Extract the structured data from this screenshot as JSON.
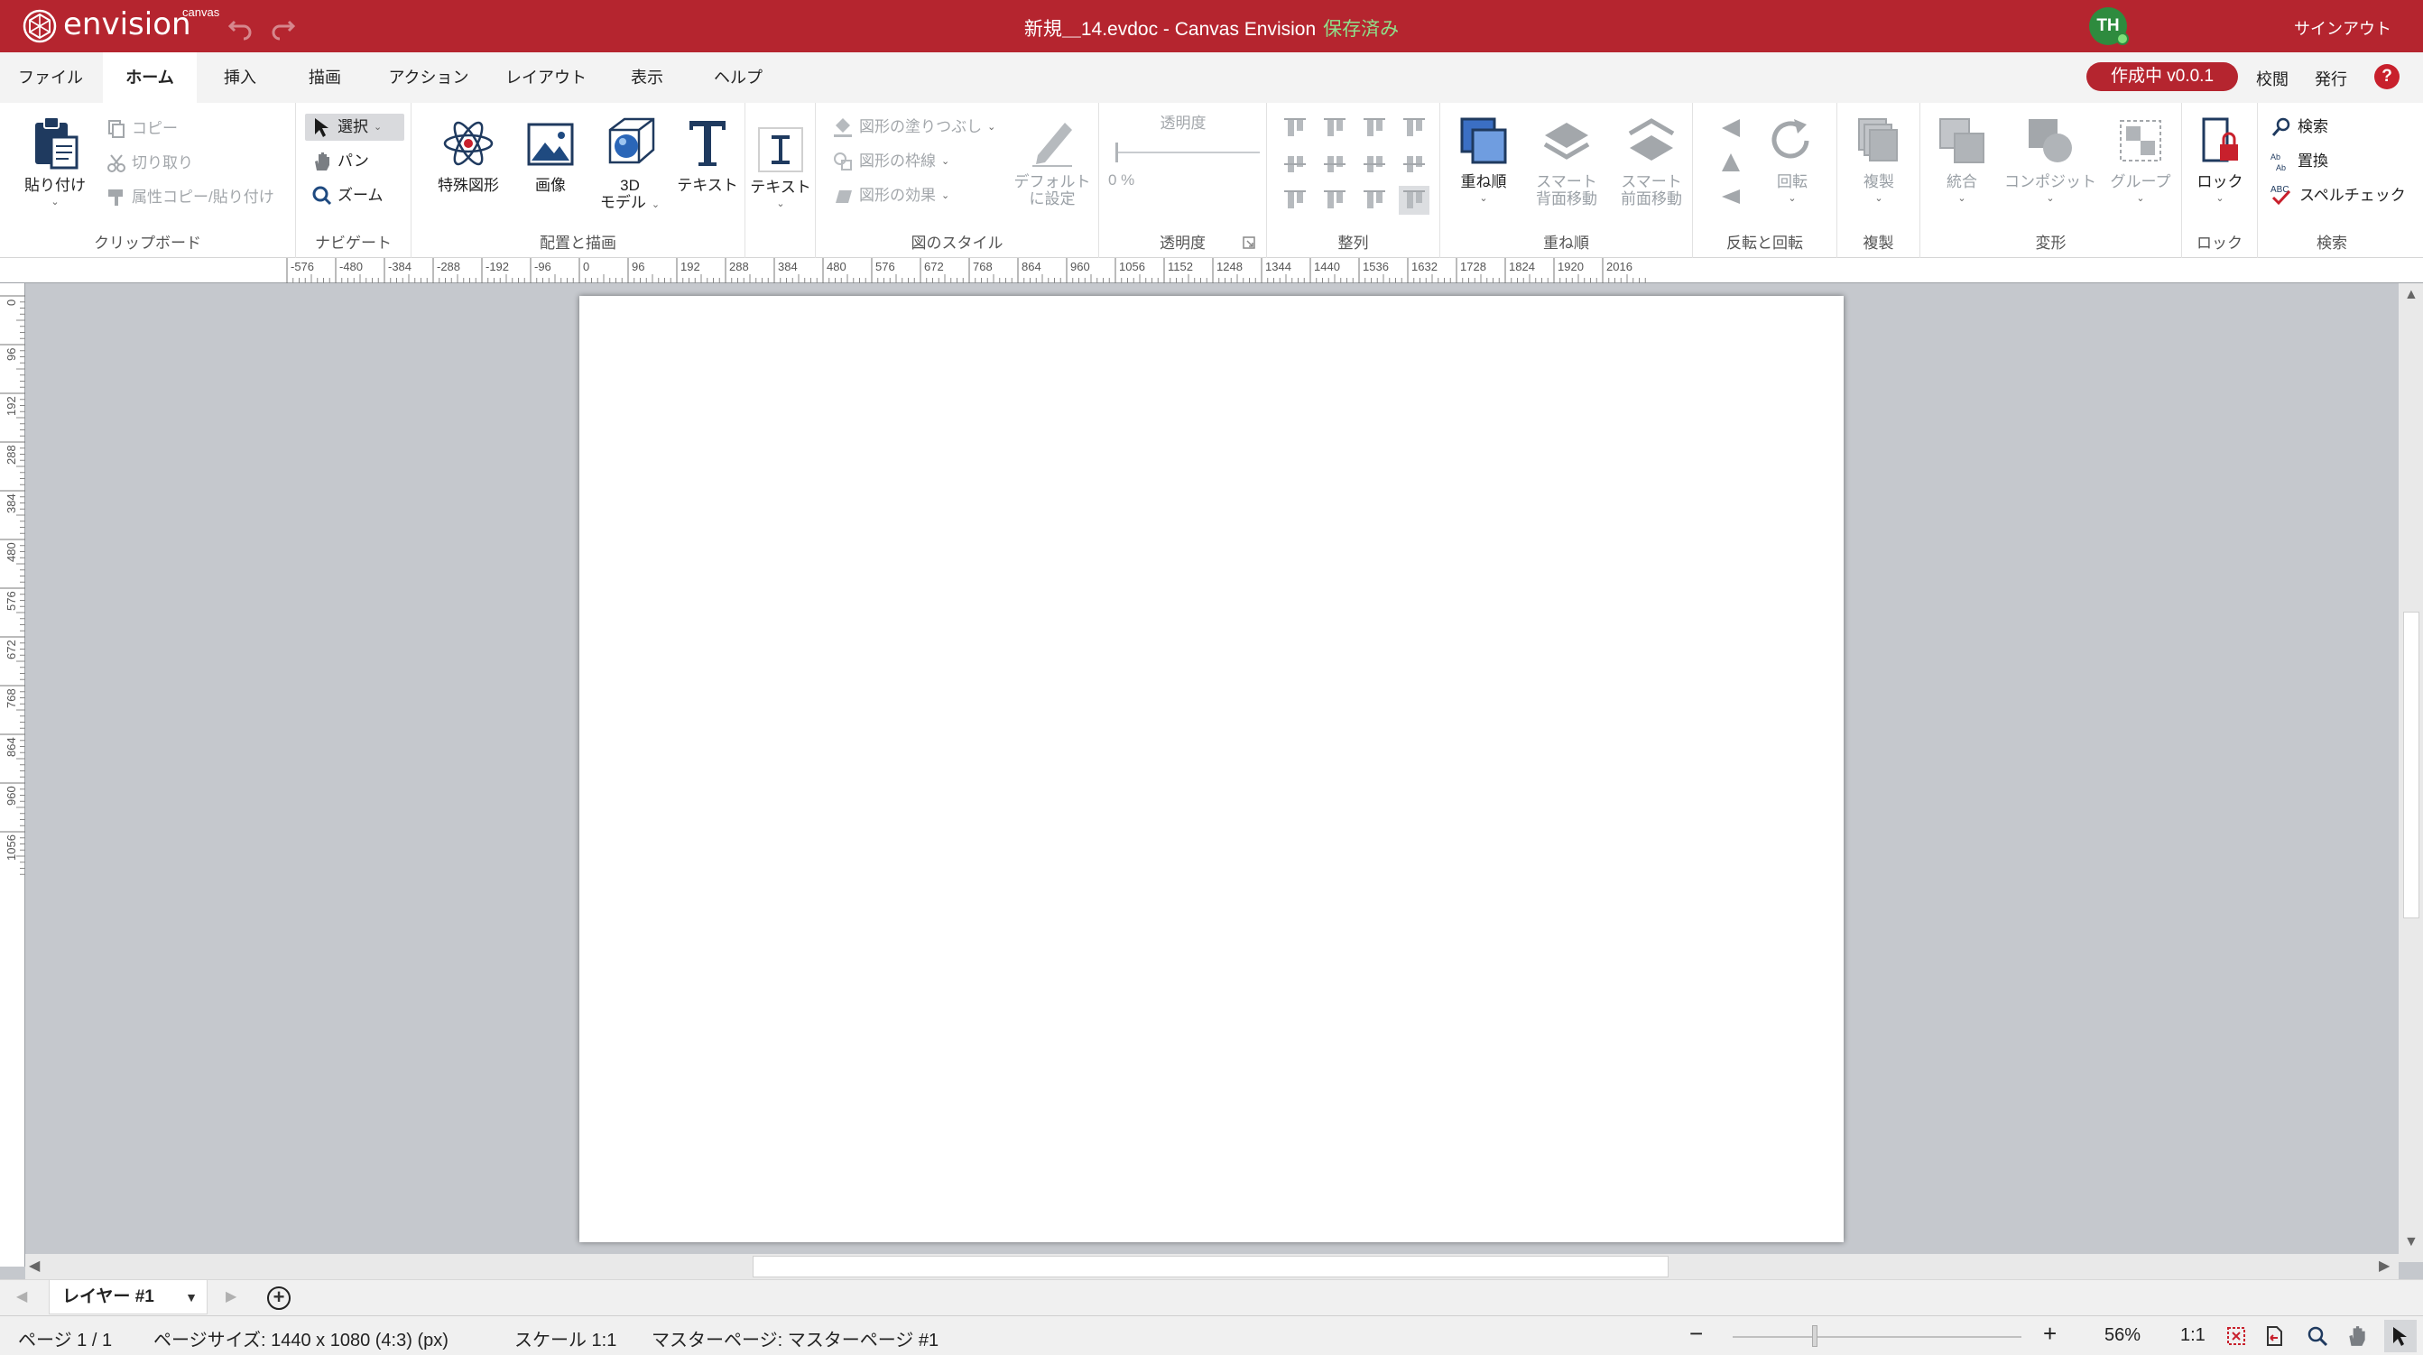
{
  "app": {
    "logo_text": "envision",
    "logo_sub": "canvas",
    "document_title": "新規＿14.evdoc - Canvas Envision",
    "saved_status": "保存済み",
    "user_initials": "TH",
    "signout_label": "サインアウト"
  },
  "menu": {
    "tabs": [
      "ファイル",
      "ホーム",
      "挿入",
      "描画",
      "アクション",
      "レイアウト",
      "表示",
      "ヘルプ"
    ],
    "active_tab": "ホーム",
    "status_badge": "作成中 v0.0.1",
    "review_label": "校閲",
    "publish_label": "発行",
    "help_label": "?"
  },
  "ribbon": {
    "clipboard": {
      "label": "クリップボード",
      "paste": "貼り付け",
      "copy": "コピー",
      "cut": "切り取り",
      "format_painter": "属性コピー/貼り付け"
    },
    "navigate": {
      "label": "ナビゲート",
      "select": "選択",
      "pan": "パン",
      "zoom": "ズーム"
    },
    "place_draw": {
      "label": "配置と描画",
      "special_shapes": "特殊図形",
      "image": "画像",
      "model_3d_line1": "3D",
      "model_3d_line2": "モデル",
      "text": "テキスト"
    },
    "text_tool": {
      "label": "テキスト"
    },
    "shape_style": {
      "label": "図のスタイル",
      "fill": "図形の塗りつぶし",
      "outline": "図形の枠線",
      "effects": "図形の効果",
      "set_default_line1": "デフォルト",
      "set_default_line2": "に設定"
    },
    "transparency": {
      "label": "透明度",
      "title": "透明度",
      "value": "0 %",
      "fraction": 0.0
    },
    "align": {
      "label": "整列"
    },
    "order": {
      "label": "重ね順",
      "order": "重ね順",
      "smart_back_line1": "スマート",
      "smart_back_line2": "背面移動",
      "smart_front_line1": "スマート",
      "smart_front_line2": "前面移動"
    },
    "flip_rotate": {
      "label": "反転と回転",
      "rotate": "回転"
    },
    "duplicate": {
      "label": "複製",
      "duplicate": "複製"
    },
    "transform": {
      "label": "変形",
      "combine": "統合",
      "composite": "コンポジット",
      "group": "グループ"
    },
    "lock": {
      "label": "ロック",
      "lock": "ロック"
    },
    "search": {
      "label": "検索",
      "find": "検索",
      "replace": "置換",
      "spellcheck": "スペルチェック",
      "abc": "ABC"
    }
  },
  "rulers": {
    "horizontal": [
      "-576",
      "-480",
      "-384",
      "-288",
      "-192",
      "-96",
      "0",
      "96",
      "192",
      "288",
      "384",
      "480",
      "576",
      "672",
      "768",
      "864",
      "960",
      "1056",
      "1152",
      "1248",
      "1344",
      "1440",
      "1536",
      "1632",
      "1728",
      "1824",
      "1920",
      "2016"
    ],
    "vertical": [
      "0",
      "96",
      "192",
      "288",
      "384",
      "480",
      "576",
      "672",
      "768",
      "864",
      "960",
      "1056"
    ]
  },
  "layers": {
    "current": "レイヤー #1"
  },
  "status": {
    "page": "ページ 1 / 1",
    "page_size": "ページサイズ: 1440 x 1080 (4:3) (px)",
    "scale": "スケール 1:1",
    "master_page": "マスターページ: マスターページ #1",
    "zoom_minus": "−",
    "zoom_plus": "+",
    "zoom": "56%",
    "ratio": "1:1"
  },
  "colors": {
    "brand_red": "#b5252f",
    "saved_green": "#8fe08a",
    "avatar_green": "#2e8b3e",
    "canvas_gray": "#c5c8cd"
  }
}
